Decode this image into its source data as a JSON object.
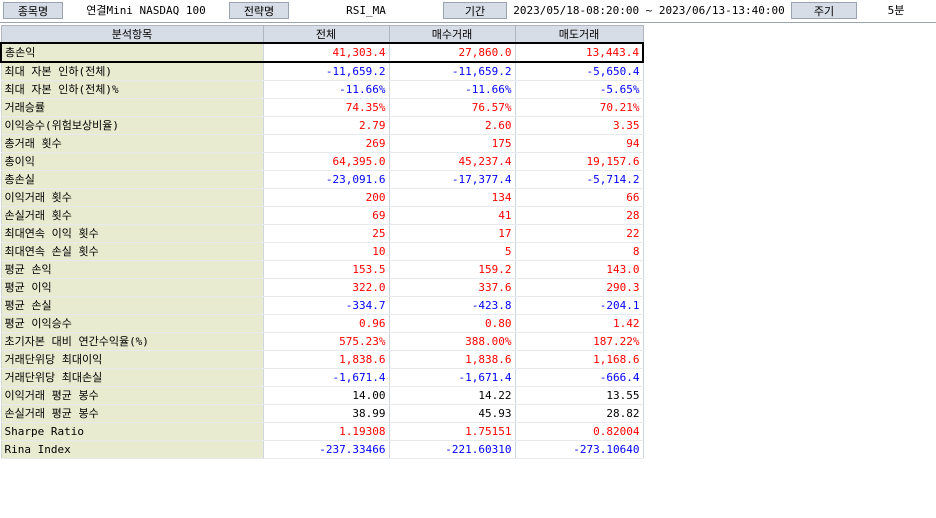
{
  "header": {
    "item_label": "종목명",
    "item_value": "연결Mini NASDAQ 100",
    "strategy_label": "전략명",
    "strategy_value": "RSI_MA",
    "period_label": "기간",
    "period_value": "2023/05/18-08:20:00 ~ 2023/06/13-13:40:00",
    "cycle_label": "주기",
    "cycle_value": "5분"
  },
  "colors": {
    "positive": "#ff0000",
    "negative": "#0000ff",
    "neutral": "#000000",
    "label_bg": "#e8ebcf",
    "header_bg": "#d7dde6"
  },
  "table": {
    "columns": [
      "분석항목",
      "전체",
      "매수거래",
      "매도거래"
    ],
    "rows": [
      {
        "name": "총손익",
        "values": [
          "41,303.4",
          "27,860.0",
          "13,443.4"
        ],
        "tone": "pos",
        "selected": true
      },
      {
        "name": "최대 자본 인하(전체)",
        "values": [
          "-11,659.2",
          "-11,659.2",
          "-5,650.4"
        ],
        "tone": "neg"
      },
      {
        "name": "최대 자본 인하(전체)%",
        "values": [
          "-11.66%",
          "-11.66%",
          "-5.65%"
        ],
        "tone": "neg"
      },
      {
        "name": "거래승률",
        "values": [
          "74.35%",
          "76.57%",
          "70.21%"
        ],
        "tone": "pos"
      },
      {
        "name": "이익승수(위험보상비율)",
        "values": [
          "2.79",
          "2.60",
          "3.35"
        ],
        "tone": "pos"
      },
      {
        "name": "총거래 횟수",
        "values": [
          "269",
          "175",
          "94"
        ],
        "tone": "pos"
      },
      {
        "name": "총이익",
        "values": [
          "64,395.0",
          "45,237.4",
          "19,157.6"
        ],
        "tone": "pos"
      },
      {
        "name": "총손실",
        "values": [
          "-23,091.6",
          "-17,377.4",
          "-5,714.2"
        ],
        "tone": "neg"
      },
      {
        "name": "이익거래 횟수",
        "values": [
          "200",
          "134",
          "66"
        ],
        "tone": "pos"
      },
      {
        "name": "손실거래 횟수",
        "values": [
          "69",
          "41",
          "28"
        ],
        "tone": "pos"
      },
      {
        "name": "최대연속 이익 횟수",
        "values": [
          "25",
          "17",
          "22"
        ],
        "tone": "pos"
      },
      {
        "name": "최대연속 손실 횟수",
        "values": [
          "10",
          "5",
          "8"
        ],
        "tone": "pos"
      },
      {
        "name": "평균 손익",
        "values": [
          "153.5",
          "159.2",
          "143.0"
        ],
        "tone": "pos"
      },
      {
        "name": "평균 이익",
        "values": [
          "322.0",
          "337.6",
          "290.3"
        ],
        "tone": "pos"
      },
      {
        "name": "평균 손실",
        "values": [
          "-334.7",
          "-423.8",
          "-204.1"
        ],
        "tone": "neg"
      },
      {
        "name": "평균 이익승수",
        "values": [
          "0.96",
          "0.80",
          "1.42"
        ],
        "tone": "pos"
      },
      {
        "name": "초기자본 대비 연간수익율(%)",
        "values": [
          "575.23%",
          "388.00%",
          "187.22%"
        ],
        "tone": "pos"
      },
      {
        "name": "거래단위당 최대이익",
        "values": [
          "1,838.6",
          "1,838.6",
          "1,168.6"
        ],
        "tone": "pos"
      },
      {
        "name": "거래단위당 최대손실",
        "values": [
          "-1,671.4",
          "-1,671.4",
          "-666.4"
        ],
        "tone": "neg"
      },
      {
        "name": "이익거래 평균 봉수",
        "values": [
          "14.00",
          "14.22",
          "13.55"
        ],
        "tone": "neutral"
      },
      {
        "name": "손실거래 평균 봉수",
        "values": [
          "38.99",
          "45.93",
          "28.82"
        ],
        "tone": "neutral"
      },
      {
        "name": "Sharpe Ratio",
        "values": [
          "1.19308",
          "1.75151",
          "0.82004"
        ],
        "tone": "pos"
      },
      {
        "name": "Rina Index",
        "values": [
          "-237.33466",
          "-221.60310",
          "-273.10640"
        ],
        "tone": "neg"
      }
    ]
  }
}
